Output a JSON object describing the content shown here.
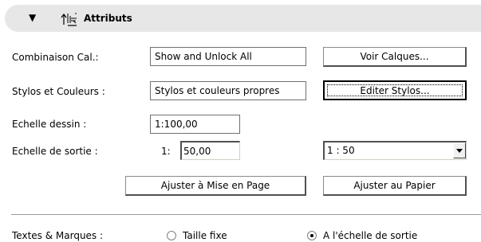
{
  "header": {
    "title": "Attributs",
    "toggle_icon": "triangle-down-icon",
    "section_icon": "attributes-icon"
  },
  "rows": {
    "combinaison": {
      "label": "Combinaison Cal.:",
      "value": "Show and Unlock All",
      "button": "Voir Calques..."
    },
    "stylos": {
      "label": "Stylos et Couleurs :",
      "value": "Stylos et couleurs propres",
      "button": "Editer Stylos..."
    },
    "echelle_dessin": {
      "label": "Echelle dessin :",
      "value": "1:100,00"
    },
    "echelle_sortie": {
      "label": "Echelle de sortie :",
      "prefix": "1:",
      "value": "50,00",
      "select_value": "1 : 50"
    }
  },
  "buttons": {
    "ajuster_mise_en_page": "Ajuster à Mise en Page",
    "ajuster_papier": "Ajuster au Papier"
  },
  "textes": {
    "label": "Textes & Marques :",
    "options": [
      {
        "label": "Taille fixe",
        "selected": false
      },
      {
        "label": "A l'échelle de sortie",
        "selected": true
      }
    ]
  }
}
